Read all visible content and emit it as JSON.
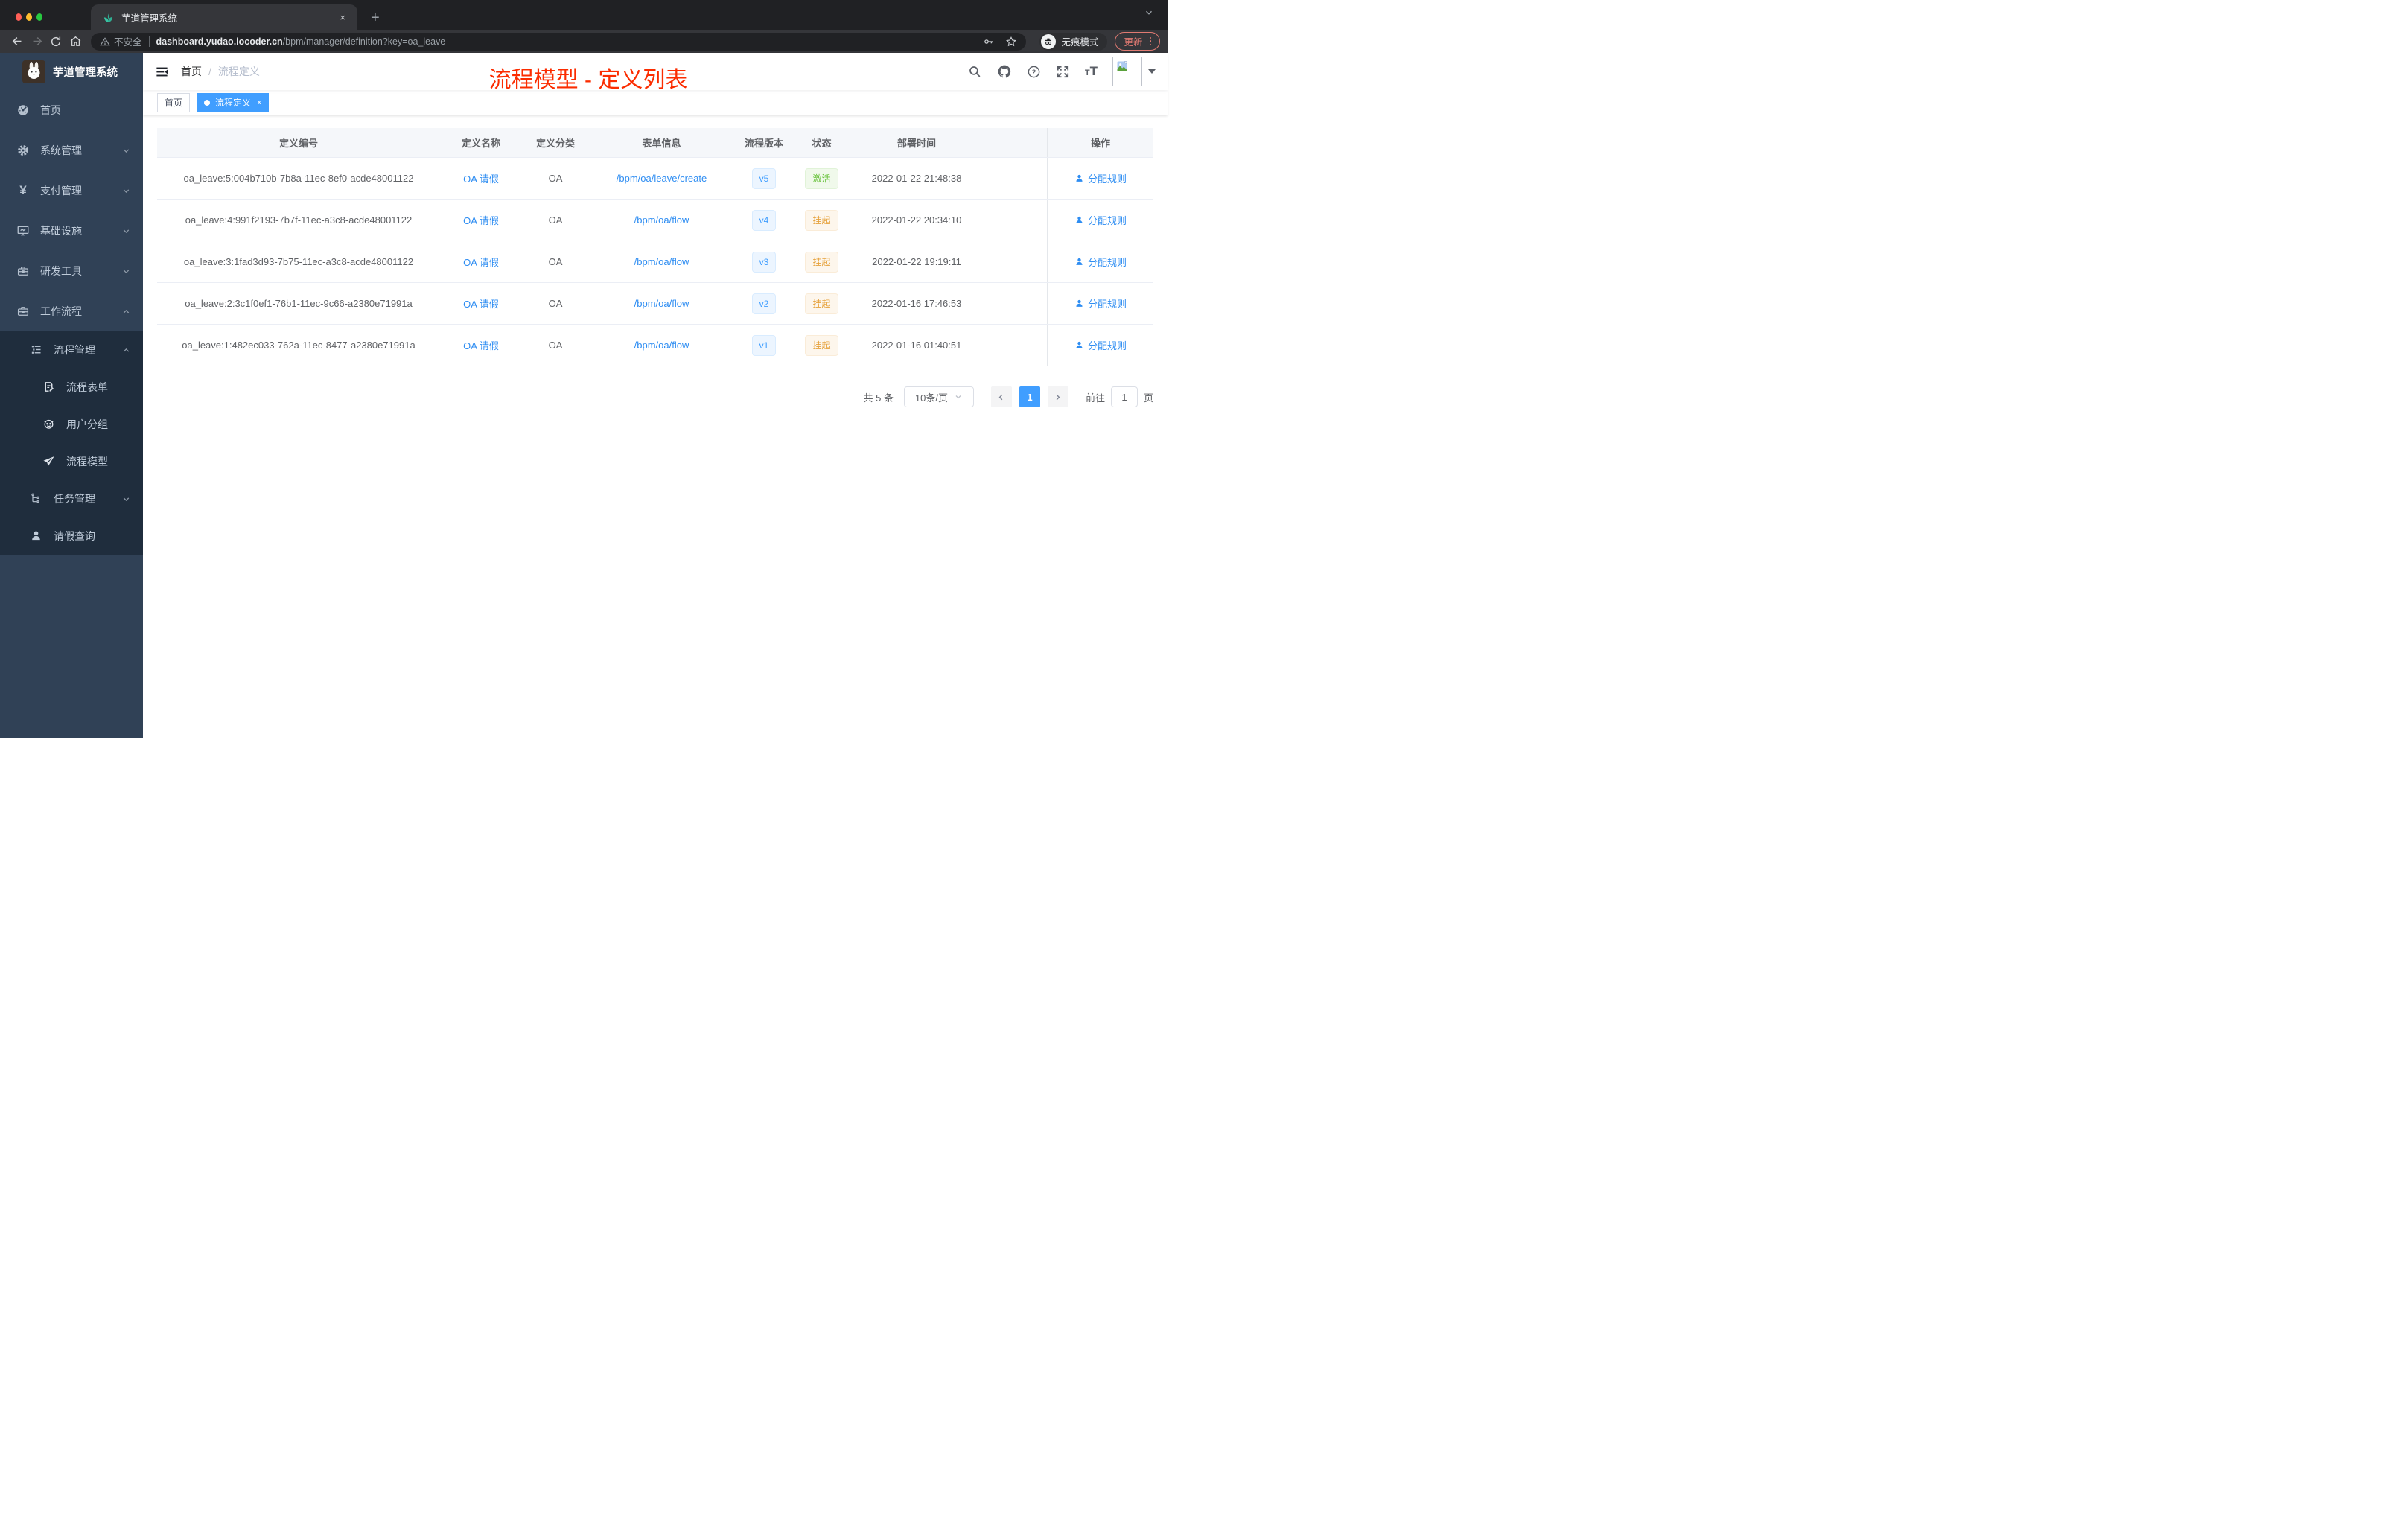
{
  "browser": {
    "tab_title": "芋道管理系统",
    "glyph_close": "×",
    "glyph_plus": "+",
    "security_label": "不安全",
    "url_host": "dashboard.yudao.iocoder.cn",
    "url_path": "/bpm/manager/definition?key=oa_leave",
    "incognito_label": "无痕模式",
    "update_label": "更新"
  },
  "sidebar": {
    "brand": "芋道管理系统",
    "items": [
      {
        "label": "首页",
        "icon": "dashboard-icon"
      },
      {
        "label": "系统管理",
        "icon": "gear-icon"
      },
      {
        "label": "支付管理",
        "icon": "yen-icon"
      },
      {
        "label": "基础设施",
        "icon": "monitor-icon"
      },
      {
        "label": "研发工具",
        "icon": "toolbox-icon"
      },
      {
        "label": "工作流程",
        "icon": "workflow-icon"
      },
      {
        "label": "流程管理",
        "icon": "list-icon"
      },
      {
        "label": "流程表单",
        "icon": "form-icon"
      },
      {
        "label": "用户分组",
        "icon": "user-group-icon"
      },
      {
        "label": "流程模型",
        "icon": "paper-plane-icon"
      },
      {
        "label": "任务管理",
        "icon": "task-tree-icon"
      },
      {
        "label": "请假查询",
        "icon": "person-icon"
      }
    ]
  },
  "navbar": {
    "breadcrumb_home": "首页",
    "breadcrumb_separator": "/",
    "breadcrumb_current": "流程定义"
  },
  "annotation": {
    "title": "流程模型 - 定义列表",
    "color": "#fb2c00"
  },
  "tags_view": {
    "tags": [
      {
        "label": "首页"
      },
      {
        "label": "流程定义"
      }
    ]
  },
  "table": {
    "columns": [
      "定义编号",
      "定义名称",
      "定义分类",
      "表单信息",
      "流程版本",
      "状态",
      "部署时间",
      "操作"
    ],
    "rows": [
      {
        "id": "oa_leave:5:004b710b-7b8a-11ec-8ef0-acde48001122",
        "name": "OA 请假",
        "category": "OA",
        "form": "/bpm/oa/leave/create",
        "version": "v5",
        "status": "激活",
        "status_type": "success",
        "deploy_time": "2022-01-22 21:48:38",
        "action": "分配规则"
      },
      {
        "id": "oa_leave:4:991f2193-7b7f-11ec-a3c8-acde48001122",
        "name": "OA 请假",
        "category": "OA",
        "form": "/bpm/oa/flow",
        "version": "v4",
        "status": "挂起",
        "status_type": "warning",
        "deploy_time": "2022-01-22 20:34:10",
        "action": "分配规则"
      },
      {
        "id": "oa_leave:3:1fad3d93-7b75-11ec-a3c8-acde48001122",
        "name": "OA 请假",
        "category": "OA",
        "form": "/bpm/oa/flow",
        "version": "v3",
        "status": "挂起",
        "status_type": "warning",
        "deploy_time": "2022-01-22 19:19:11",
        "action": "分配规则"
      },
      {
        "id": "oa_leave:2:3c1f0ef1-76b1-11ec-9c66-a2380e71991a",
        "name": "OA 请假",
        "category": "OA",
        "form": "/bpm/oa/flow",
        "version": "v2",
        "status": "挂起",
        "status_type": "warning",
        "deploy_time": "2022-01-16 17:46:53",
        "action": "分配规则"
      },
      {
        "id": "oa_leave:1:482ec033-762a-11ec-8477-a2380e71991a",
        "name": "OA 请假",
        "category": "OA",
        "form": "/bpm/oa/flow",
        "version": "v1",
        "status": "挂起",
        "status_type": "warning",
        "deploy_time": "2022-01-16 01:40:51",
        "action": "分配规则"
      }
    ]
  },
  "pagination": {
    "total": "共 5 条",
    "page_size": "10条/页",
    "current": "1",
    "goto_label": "前往",
    "goto_value": "1",
    "unit": "页"
  },
  "colors": {
    "primary": "#409eff",
    "link": "#2e8df2",
    "success": "#67c23a",
    "warning": "#e6a23c",
    "annotation": "#fb2c00",
    "sidebar_bg": "#304156",
    "submenu_bg": "#1f2d3d"
  }
}
